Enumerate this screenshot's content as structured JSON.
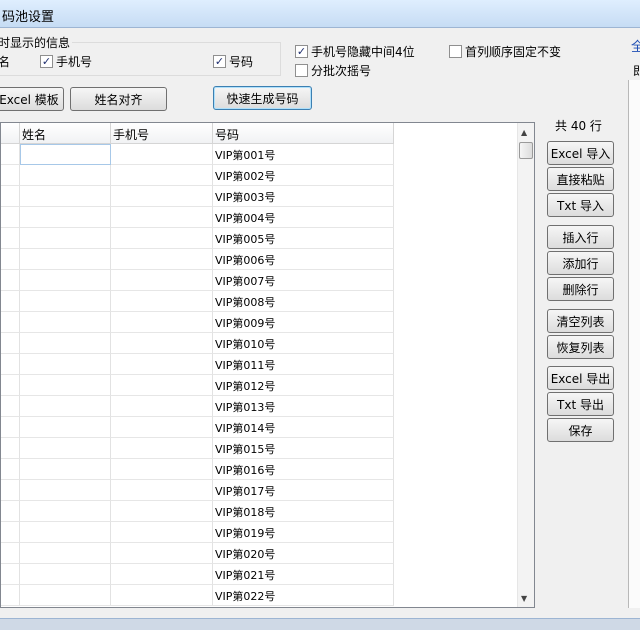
{
  "window": {
    "title": "码池设置"
  },
  "display_group": {
    "title": "时显示的信息",
    "name_label": "名",
    "phone": {
      "label": "手机号",
      "checked": true
    },
    "code": {
      "label": "号码",
      "checked": true
    }
  },
  "options": {
    "hide_middle": {
      "label": "手机号隐藏中间4位",
      "checked": true
    },
    "batch": {
      "label": "分批次摇号",
      "checked": false
    },
    "first_column_fixed": {
      "label": "首列顺序固定不变",
      "checked": false
    }
  },
  "right_edge_text": {
    "top": "全",
    "second": "即"
  },
  "toolbar": {
    "excel_template": "Excel 模板",
    "name_align": "姓名对齐",
    "quick_generate": "快速生成号码"
  },
  "total_rows_label": "共 40 行",
  "side_buttons": {
    "excel_import": "Excel 导入",
    "paste": "直接粘贴",
    "txt_import": "Txt 导入",
    "insert_row": "插入行",
    "add_row": "添加行",
    "delete_row": "删除行",
    "clear_list": "清空列表",
    "restore_list": "恢复列表",
    "excel_export": "Excel 导出",
    "txt_export": "Txt 导出",
    "save": "保存"
  },
  "grid": {
    "columns": [
      "姓名",
      "手机号",
      "号码"
    ],
    "rows": [
      {
        "name": "",
        "phone": "",
        "code": "VIP第001号"
      },
      {
        "name": "",
        "phone": "",
        "code": "VIP第002号"
      },
      {
        "name": "",
        "phone": "",
        "code": "VIP第003号"
      },
      {
        "name": "",
        "phone": "",
        "code": "VIP第004号"
      },
      {
        "name": "",
        "phone": "",
        "code": "VIP第005号"
      },
      {
        "name": "",
        "phone": "",
        "code": "VIP第006号"
      },
      {
        "name": "",
        "phone": "",
        "code": "VIP第007号"
      },
      {
        "name": "",
        "phone": "",
        "code": "VIP第008号"
      },
      {
        "name": "",
        "phone": "",
        "code": "VIP第009号"
      },
      {
        "name": "",
        "phone": "",
        "code": "VIP第010号"
      },
      {
        "name": "",
        "phone": "",
        "code": "VIP第011号"
      },
      {
        "name": "",
        "phone": "",
        "code": "VIP第012号"
      },
      {
        "name": "",
        "phone": "",
        "code": "VIP第013号"
      },
      {
        "name": "",
        "phone": "",
        "code": "VIP第014号"
      },
      {
        "name": "",
        "phone": "",
        "code": "VIP第015号"
      },
      {
        "name": "",
        "phone": "",
        "code": "VIP第016号"
      },
      {
        "name": "",
        "phone": "",
        "code": "VIP第017号"
      },
      {
        "name": "",
        "phone": "",
        "code": "VIP第018号"
      },
      {
        "name": "",
        "phone": "",
        "code": "VIP第019号"
      },
      {
        "name": "",
        "phone": "",
        "code": "VIP第020号"
      },
      {
        "name": "",
        "phone": "",
        "code": "VIP第021号"
      },
      {
        "name": "",
        "phone": "",
        "code": "VIP第022号"
      }
    ]
  },
  "icons": {
    "scroll_up": "scroll-up-arrow-icon",
    "scroll_down": "scroll-down-arrow-icon",
    "check": "check-icon"
  }
}
